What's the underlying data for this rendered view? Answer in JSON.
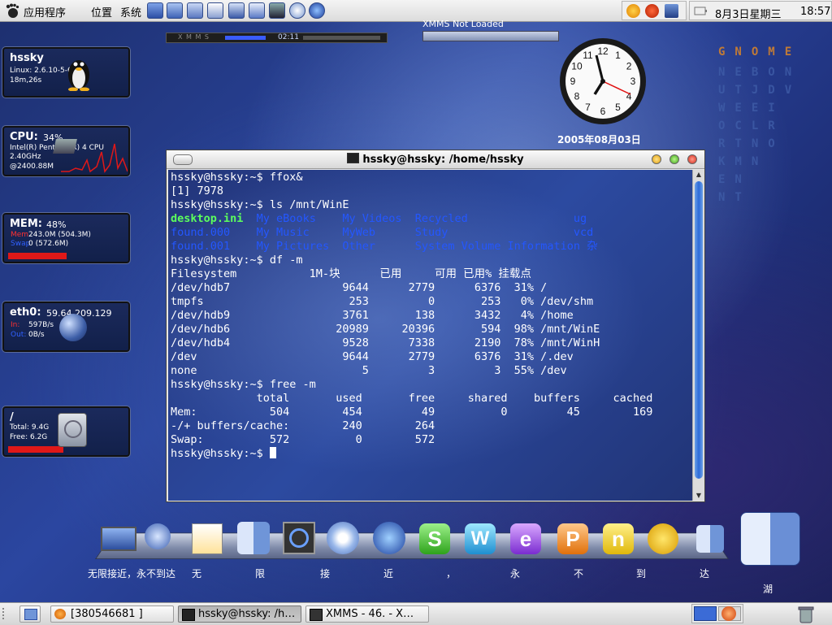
{
  "top_panel": {
    "menus": [
      "应用程序",
      "位置",
      "系统"
    ],
    "clock": {
      "date": "8月3日星期三",
      "time": "18:57"
    }
  },
  "desklets": {
    "host": {
      "title": "hssky",
      "kernel": "Linux: 2.6.10-5-686",
      "uptime": "18m,26s"
    },
    "cpu": {
      "title": "CPU:",
      "percent": "34%",
      "model": "Intel(R) Pentium(R) 4 CPU",
      "freq": "2.40GHz",
      "mhz": "@2400.88M"
    },
    "mem": {
      "title": "MEM:",
      "percent": "48%",
      "mem_label": "Mem",
      "mem_value": "243.0M (504.3M)",
      "swap_label": "Swap",
      "swap_value": "0 (572.6M)",
      "used_fraction": 0.48
    },
    "net": {
      "title": "eth0:",
      "ip": "59.64.209.129",
      "in_label": "In:",
      "in_value": "597B/s",
      "out_label": "Out:",
      "out_value": "0B/s"
    },
    "disk": {
      "title": "/",
      "total": "Total: 9.4G",
      "free": "Free: 6.2G",
      "used_fraction": 0.34
    }
  },
  "xmms": {
    "title": "XMMS Not Loaded",
    "time": "02:11",
    "logo": "X M M S"
  },
  "analog_clock": {
    "date": "2005年08月03日",
    "numbers": [
      "12",
      "1",
      "2",
      "3",
      "4",
      "5",
      "6",
      "7",
      "8",
      "9",
      "10",
      "11"
    ]
  },
  "gnome_letters": {
    "col1": "GNEUWOR K",
    "title_row": "GNOME",
    "rows": [
      "NEBON",
      "UTJDV",
      "WEEI",
      "OCLR",
      "RTNO",
      "KMN",
      "EN",
      "NT"
    ]
  },
  "terminal": {
    "title": "hssky@hssky: /home/hssky",
    "colors": {
      "dir": "#2457ff",
      "ini": "#5cff5c",
      "text": "#ffffff"
    }
  },
  "dock": {
    "labels": [
      {
        "text": "无限接近，永不到达"
      },
      {
        "text": "无"
      },
      {
        "text": "限"
      },
      {
        "text": "接"
      },
      {
        "text": "近"
      },
      {
        "text": "，"
      },
      {
        "text": "永"
      },
      {
        "text": "不"
      },
      {
        "text": "到"
      },
      {
        "text": "达"
      },
      {
        "text": "湖"
      }
    ]
  },
  "taskbar": {
    "tasks": [
      {
        "label": "[380546681 ]"
      },
      {
        "label": "hssky@hssky: /h…"
      },
      {
        "label": "XMMS - 46. - X…"
      }
    ]
  }
}
